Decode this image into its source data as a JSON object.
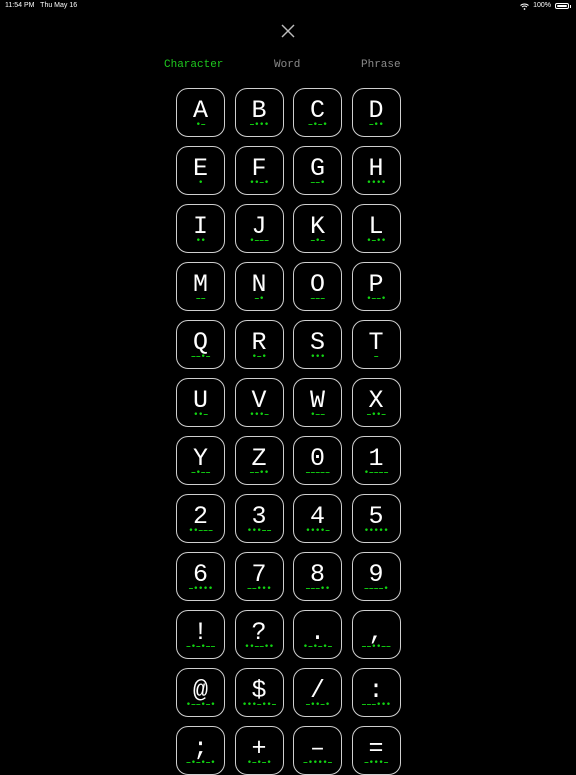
{
  "status": {
    "time": "11:54 PM",
    "date": "Thu May 16",
    "battery": "100%"
  },
  "tabs": [
    {
      "label": "Character",
      "active": true
    },
    {
      "label": "Word",
      "active": false
    },
    {
      "label": "Phrase",
      "active": false
    }
  ],
  "colors": {
    "accent": "#1ec81e",
    "background": "#000000",
    "inactive_tab": "#8a8a8a"
  },
  "keys": [
    {
      "char": "A",
      "code": "•–"
    },
    {
      "char": "B",
      "code": "–•••"
    },
    {
      "char": "C",
      "code": "–•–•"
    },
    {
      "char": "D",
      "code": "–••"
    },
    {
      "char": "E",
      "code": "•"
    },
    {
      "char": "F",
      "code": "••–•"
    },
    {
      "char": "G",
      "code": "––•"
    },
    {
      "char": "H",
      "code": "••••"
    },
    {
      "char": "I",
      "code": "••"
    },
    {
      "char": "J",
      "code": "•–––"
    },
    {
      "char": "K",
      "code": "–•–"
    },
    {
      "char": "L",
      "code": "•–••"
    },
    {
      "char": "M",
      "code": "––"
    },
    {
      "char": "N",
      "code": "–•"
    },
    {
      "char": "O",
      "code": "–––"
    },
    {
      "char": "P",
      "code": "•––•"
    },
    {
      "char": "Q",
      "code": "––•–"
    },
    {
      "char": "R",
      "code": "•–•"
    },
    {
      "char": "S",
      "code": "•••"
    },
    {
      "char": "T",
      "code": "–"
    },
    {
      "char": "U",
      "code": "••–"
    },
    {
      "char": "V",
      "code": "•••–"
    },
    {
      "char": "W",
      "code": "•––"
    },
    {
      "char": "X",
      "code": "–••–"
    },
    {
      "char": "Y",
      "code": "–•––"
    },
    {
      "char": "Z",
      "code": "––••"
    },
    {
      "char": "0",
      "code": "–––––"
    },
    {
      "char": "1",
      "code": "•––––"
    },
    {
      "char": "2",
      "code": "••–––"
    },
    {
      "char": "3",
      "code": "•••––"
    },
    {
      "char": "4",
      "code": "••••–"
    },
    {
      "char": "5",
      "code": "•••••"
    },
    {
      "char": "6",
      "code": "–••••"
    },
    {
      "char": "7",
      "code": "––•••"
    },
    {
      "char": "8",
      "code": "–––••"
    },
    {
      "char": "9",
      "code": "––––•"
    },
    {
      "char": "!",
      "code": "–•–•––"
    },
    {
      "char": "?",
      "code": "••––••"
    },
    {
      "char": ".",
      "code": "•–•–•–"
    },
    {
      "char": ",",
      "code": "––••––"
    },
    {
      "char": "@",
      "code": "•––•–•"
    },
    {
      "char": "$",
      "code": "•••–••–"
    },
    {
      "char": "/",
      "code": "–••–•"
    },
    {
      "char": ":",
      "code": "–––•••"
    },
    {
      "char": ";",
      "code": "–•–•–•"
    },
    {
      "char": "+",
      "code": "•–•–•"
    },
    {
      "char": "–",
      "code": "–••••–"
    },
    {
      "char": "=",
      "code": "–•••–"
    }
  ]
}
